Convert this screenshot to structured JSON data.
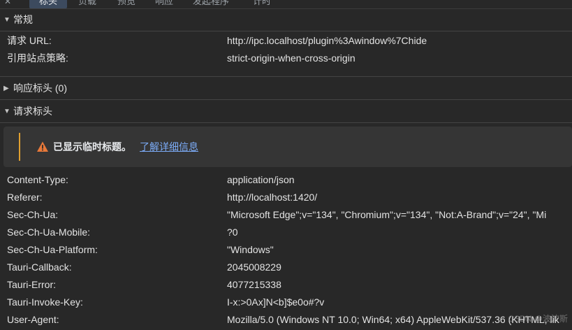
{
  "tabs": [
    {
      "label": "标头",
      "active": true
    },
    {
      "label": "负载",
      "active": false
    },
    {
      "label": "预览",
      "active": false
    },
    {
      "label": "响应",
      "active": false
    },
    {
      "label": "发起程序",
      "active": false
    },
    {
      "label": "计时",
      "active": false
    }
  ],
  "sections": {
    "general": {
      "title": "常规",
      "expanded": true
    },
    "response_headers": {
      "title": "响应标头 (0)",
      "expanded": false
    },
    "request_headers": {
      "title": "请求标头",
      "expanded": true
    }
  },
  "general_rows": [
    {
      "key": "请求 URL:",
      "value": "http://ipc.localhost/plugin%3Awindow%7Chide"
    },
    {
      "key": "引用站点策略:",
      "value": "strict-origin-when-cross-origin"
    }
  ],
  "notice": {
    "message": "已显示临时标题。",
    "link": "了解详细信息",
    "color": "#e0a030"
  },
  "request_rows": [
    {
      "key": "Content-Type:",
      "value": "application/json"
    },
    {
      "key": "Referer:",
      "value": "http://localhost:1420/"
    },
    {
      "key": "Sec-Ch-Ua:",
      "value": "\"Microsoft Edge\";v=\"134\", \"Chromium\";v=\"134\", \"Not:A-Brand\";v=\"24\", \"Mi"
    },
    {
      "key": "Sec-Ch-Ua-Mobile:",
      "value": "?0"
    },
    {
      "key": "Sec-Ch-Ua-Platform:",
      "value": "\"Windows\""
    },
    {
      "key": "Tauri-Callback:",
      "value": "2045008229"
    },
    {
      "key": "Tauri-Error:",
      "value": "4077215338"
    },
    {
      "key": "Tauri-Invoke-Key:",
      "value": "I-x:>0Ax]N<b]$e0o#?v"
    },
    {
      "key": "User-Agent:",
      "value": "Mozilla/5.0 (Windows NT 10.0; Win64; x64) AppleWebKit/537.36 (KHTML, lik"
    }
  ],
  "watermark": "CSDN @波波斯"
}
